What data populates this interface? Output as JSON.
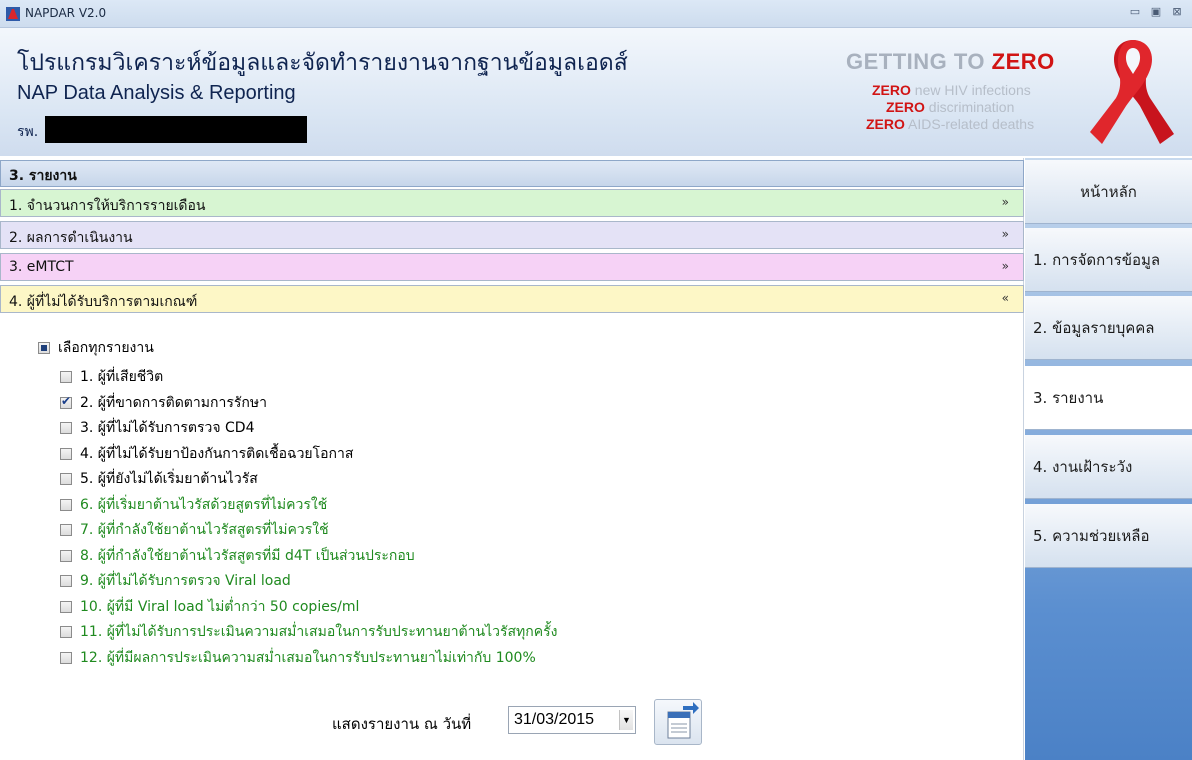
{
  "window": {
    "title": "NAPDAR V2.0"
  },
  "header": {
    "title_thai": "โปรแกรมวิเคราะห์ข้อมูลและจัดทำรายงานจากฐานข้อมูลเอดส์",
    "title_eng": "NAP Data Analysis & Reporting",
    "hospital_label": "รพ.",
    "slogan": {
      "getting_to": "GETTING TO",
      "zero": "ZERO",
      "lines": [
        {
          "zero": "ZERO",
          "text": "new HIV infections"
        },
        {
          "zero": "ZERO",
          "text": "discrimination"
        },
        {
          "zero": "ZERO",
          "text": "AIDS-related deaths"
        }
      ]
    }
  },
  "section": {
    "title": "3. รายงาน"
  },
  "accordion": [
    {
      "label": "1. จำนวนการให้บริการรายเดือน",
      "color": "#d7f5d2",
      "chevron": "»"
    },
    {
      "label": "2. ผลการดำเนินงาน",
      "color": "#e4e2f6",
      "chevron": "»"
    },
    {
      "label": "3. eMTCT",
      "color": "#f6d2f6",
      "chevron": "»"
    },
    {
      "label": "4. ผู้ที่ไม่ได้รับบริการตามเกณฑ์",
      "color": "#fdf7c6",
      "chevron": "«"
    }
  ],
  "reports": {
    "select_all": "เลือกทุกรายงาน",
    "items": [
      {
        "label": "1. ผู้ที่เสียชีวิต",
        "checked": false,
        "green": false
      },
      {
        "label": "2. ผู้ที่ขาดการติดตามการรักษา",
        "checked": true,
        "green": false
      },
      {
        "label": "3. ผู้ที่ไม่ได้รับการตรวจ CD4",
        "checked": false,
        "green": false
      },
      {
        "label": "4. ผู้ที่ไม่ได้รับยาป้องกันการติดเชื้อฉวยโอกาส",
        "checked": false,
        "green": false
      },
      {
        "label": "5. ผู้ที่ยังไม่ได้เริ่มยาต้านไวรัส",
        "checked": false,
        "green": false
      },
      {
        "label": "6. ผู้ที่เริ่มยาต้านไวรัสด้วยสูตรที่ไม่ควรใช้",
        "checked": false,
        "green": true
      },
      {
        "label": "7. ผู้ที่กำลังใช้ยาต้านไวรัสสูตรที่ไม่ควรใช้",
        "checked": false,
        "green": true
      },
      {
        "label": "8. ผู้ที่กำลังใช้ยาต้านไวรัสสูตรที่มี d4T เป็นส่วนประกอบ",
        "checked": false,
        "green": true
      },
      {
        "label": "9. ผู้ที่ไม่ได้รับการตรวจ Viral load",
        "checked": false,
        "green": true
      },
      {
        "label": "10. ผู้ที่มี Viral load ไม่ต่ำกว่า 50 copies/ml",
        "checked": false,
        "green": true
      },
      {
        "label": "11. ผู้ที่ไม่ได้รับการประเมินความสม่ำเสมอในการรับประทานยาต้านไวรัสทุกครั้ง",
        "checked": false,
        "green": true
      },
      {
        "label": "12. ผู้ที่มีผลการประเมินความสม่ำเสมอในการรับประทานยาไม่เท่ากับ 100%",
        "checked": false,
        "green": true
      }
    ]
  },
  "report_date": {
    "label": "แสดงรายงาน ณ วันที่",
    "value": "31/03/2015"
  },
  "sidebar": {
    "tabs": [
      {
        "label": "หน้าหลัก"
      },
      {
        "label": "1. การจัดการข้อมูล"
      },
      {
        "label": "2. ข้อมูลรายบุคคล"
      },
      {
        "label": "3. รายงาน"
      },
      {
        "label": "4. งานเฝ้าระวัง"
      },
      {
        "label": "5. ความช่วยเหลือ"
      }
    ],
    "active_index": 3
  }
}
